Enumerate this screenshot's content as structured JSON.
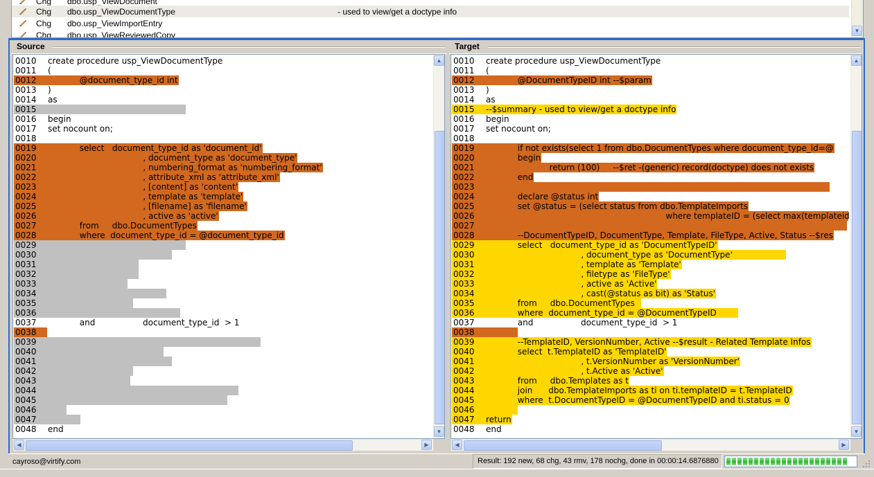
{
  "object_list": [
    {
      "kind": "Chg",
      "name": "dbo.usp_ViewDocument",
      "desc": "",
      "selected": false
    },
    {
      "kind": "Chg",
      "name": "dbo.usp_ViewDocumentType",
      "desc": "- used to view/get a doctype info",
      "selected": true
    },
    {
      "kind": "Chg",
      "name": "dbo.usp_ViewImportEntry",
      "desc": "",
      "selected": false
    },
    {
      "kind": "Chg",
      "name": "dbo.usp_ViewReviewedCopy",
      "desc": "",
      "selected": false
    }
  ],
  "source": {
    "title": "Source",
    "lines": [
      {
        "n": "0010",
        "t": "create procedure usp_ViewDocumentType",
        "hl": ""
      },
      {
        "n": "0011",
        "t": "(",
        "hl": ""
      },
      {
        "n": "0012",
        "t": "            @document_type_id int",
        "hl": "orange"
      },
      {
        "n": "0013",
        "t": ")",
        "hl": ""
      },
      {
        "n": "0014",
        "t": "as",
        "hl": ""
      },
      {
        "n": "0015",
        "t": "",
        "hl": "gray",
        "w": 248
      },
      {
        "n": "0016",
        "t": "begin",
        "hl": ""
      },
      {
        "n": "0017",
        "t": "set nocount on;",
        "hl": ""
      },
      {
        "n": "0018",
        "t": "",
        "hl": ""
      },
      {
        "n": "0019",
        "t": "            select   document_type_id as 'document_id'",
        "hl": "orange"
      },
      {
        "n": "0020",
        "t": "                                    , document_type as 'document_type'",
        "hl": "orange"
      },
      {
        "n": "0021",
        "t": "                                    , numbering_format as 'numbering_format'",
        "hl": "orange"
      },
      {
        "n": "0022",
        "t": "                                    , attribute_xml as 'attribute_xml'",
        "hl": "orange"
      },
      {
        "n": "0023",
        "t": "                                    , [content] as 'content'",
        "hl": "orange"
      },
      {
        "n": "0024",
        "t": "                                    , template as 'template'",
        "hl": "orange"
      },
      {
        "n": "0025",
        "t": "                                    , [filename] as 'filename'",
        "hl": "orange"
      },
      {
        "n": "0026",
        "t": "                                    , active as 'active'",
        "hl": "orange"
      },
      {
        "n": "0027",
        "t": "            from     dbo.DocumentTypes",
        "hl": "orange"
      },
      {
        "n": "0028",
        "t": "            where  document_type_id = @document_type_id",
        "hl": "orange"
      },
      {
        "n": "0029",
        "t": "",
        "hl": "gray",
        "w": 248
      },
      {
        "n": "0030",
        "t": "",
        "hl": "gray",
        "w": 228
      },
      {
        "n": "0031",
        "t": "",
        "hl": "gray",
        "w": 180
      },
      {
        "n": "0032",
        "t": "",
        "hl": "gray",
        "w": 180
      },
      {
        "n": "0033",
        "t": "",
        "hl": "gray",
        "w": 164
      },
      {
        "n": "0034",
        "t": "",
        "hl": "gray",
        "w": 220
      },
      {
        "n": "0035",
        "t": "",
        "hl": "gray",
        "w": 172
      },
      {
        "n": "0036",
        "t": "",
        "hl": "gray",
        "w": 240
      },
      {
        "n": "0037",
        "t": "            and                  document_type_id  > 1",
        "hl": ""
      },
      {
        "n": "0038",
        "t": "",
        "hl": "orange",
        "w": 48
      },
      {
        "n": "0039",
        "t": "",
        "hl": "gray",
        "w": 356
      },
      {
        "n": "0040",
        "t": "",
        "hl": "gray",
        "w": 216
      },
      {
        "n": "0041",
        "t": "",
        "hl": "gray",
        "w": 228
      },
      {
        "n": "0042",
        "t": "",
        "hl": "gray",
        "w": 172
      },
      {
        "n": "0043",
        "t": "",
        "hl": "gray",
        "w": 168
      },
      {
        "n": "0044",
        "t": "",
        "hl": "gray",
        "w": 324
      },
      {
        "n": "0045",
        "t": "",
        "hl": "gray",
        "w": 308
      },
      {
        "n": "0046",
        "t": "",
        "hl": "gray",
        "w": 76
      },
      {
        "n": "0047",
        "t": "",
        "hl": "gray",
        "w": 96
      },
      {
        "n": "0048",
        "t": "end",
        "hl": ""
      }
    ]
  },
  "target": {
    "title": "Target",
    "lines": [
      {
        "n": "0010",
        "t": "create procedure usp_ViewDocumentType",
        "hl": ""
      },
      {
        "n": "0011",
        "t": "(",
        "hl": ""
      },
      {
        "n": "0012",
        "t": "            @DocumentTypeID int --$param",
        "hl": "orange"
      },
      {
        "n": "0013",
        "t": ")",
        "hl": ""
      },
      {
        "n": "0014",
        "t": "as",
        "hl": ""
      },
      {
        "n": "0015",
        "t": "--$summary - used to view/get a doctype info",
        "hl": "yellow"
      },
      {
        "n": "0016",
        "t": "begin",
        "hl": ""
      },
      {
        "n": "0017",
        "t": "set nocount on;",
        "hl": ""
      },
      {
        "n": "0018",
        "t": "",
        "hl": ""
      },
      {
        "n": "0019",
        "t": "            if not exists(select 1 from dbo.DocumentTypes where document_type_id=@",
        "hl": "orange"
      },
      {
        "n": "0020",
        "t": "            begin",
        "hl": "orange"
      },
      {
        "n": "0021",
        "t": "                        return (100)     --$ret -(generic) record(doctype) does not exists",
        "hl": "orange"
      },
      {
        "n": "0022",
        "t": "            end",
        "hl": "orange"
      },
      {
        "n": "0023",
        "t": "",
        "hl": "orange",
        "w": 545
      },
      {
        "n": "0024",
        "t": "            declare @status int",
        "hl": "orange"
      },
      {
        "n": "0025",
        "t": "            set @status = (select status from dbo.TemplateImports",
        "hl": "orange"
      },
      {
        "n": "0026",
        "t": "                                                                    where templateID = (select max(templateid)",
        "hl": "orange"
      },
      {
        "n": "0027",
        "t": "",
        "hl": "orange",
        "w": 570
      },
      {
        "n": "0028",
        "t": "            --DocumentTypeID, DocumentType, Template, FileType, Active, Status --$res",
        "hl": "orange"
      },
      {
        "n": "0029",
        "t": "            select   document_type_id as 'DocumentTypeID'",
        "hl": "yellow"
      },
      {
        "n": "0030",
        "t": "                                    , document_type as 'DocumentType'                    ",
        "hl": "yellow"
      },
      {
        "n": "0031",
        "t": "                                    , template as 'Template'",
        "hl": "yellow"
      },
      {
        "n": "0032",
        "t": "                                    , filetype as 'FileType'",
        "hl": "yellow"
      },
      {
        "n": "0033",
        "t": "                                    , active as 'Active'",
        "hl": "yellow"
      },
      {
        "n": "0034",
        "t": "                                    , cast(@status as bit) as 'Status'",
        "hl": "yellow"
      },
      {
        "n": "0035",
        "t": "            from     dbo.DocumentTypes  ",
        "hl": "yellow"
      },
      {
        "n": "0036",
        "t": "            where  document_type_id = @DocumentTypeID        ",
        "hl": "yellow"
      },
      {
        "n": "0037",
        "t": "            and                  document_type_id  > 1",
        "hl": ""
      },
      {
        "n": "0038",
        "t": "",
        "hl": "orange",
        "w": 95
      },
      {
        "n": "0039",
        "t": "            --TemplateID, VersionNumber, Active --$result - Related Template Infos",
        "hl": "yellow"
      },
      {
        "n": "0040",
        "t": "            select  t.TemplateID as 'TemplateID'",
        "hl": "yellow"
      },
      {
        "n": "0041",
        "t": "                                    , t.VersionNumber as 'VersionNumber'",
        "hl": "yellow"
      },
      {
        "n": "0042",
        "t": "                                    , t.Active as 'Active'",
        "hl": "yellow"
      },
      {
        "n": "0043",
        "t": "            from     dbo.Templates as t",
        "hl": "yellow"
      },
      {
        "n": "0044",
        "t": "            join      dbo.TemplateImports as ti on ti.templateID = t.TemplateID",
        "hl": "yellow"
      },
      {
        "n": "0045",
        "t": "            where  t.DocumentTypeID = @DocumentTypeID and ti.status = 0",
        "hl": "yellow"
      },
      {
        "n": "0046",
        "t": "",
        "hl": "yellow",
        "w": 95
      },
      {
        "n": "0047",
        "t": "return",
        "hl": "yellow"
      },
      {
        "n": "0048",
        "t": "end",
        "hl": ""
      }
    ]
  },
  "status": {
    "user": "cayroso@virtify.com",
    "result": "Result: 192 new, 68 chg, 43 rmv, 178 nochg, done in 00:00:14.6876880",
    "progress_segments": 22
  },
  "colors": {
    "orange": "#d2691e",
    "gray": "#c0c0c0",
    "yellow": "#ffd700",
    "accent": "#316ac5"
  }
}
